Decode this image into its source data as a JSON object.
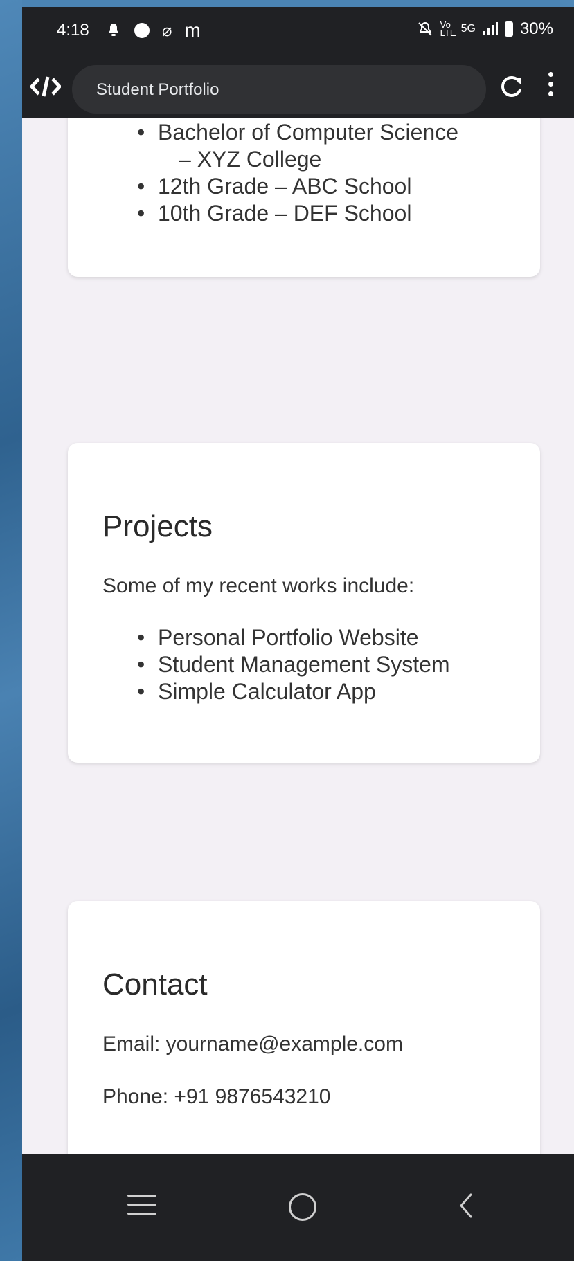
{
  "status_bar": {
    "time": "4:18",
    "left_icons": [
      "notification-icon",
      "compass-icon",
      "flash-icon",
      "m-app-icon"
    ],
    "left_glyphs": {
      "flash": "⌀",
      "m": "m"
    },
    "right_icons": [
      "mute-icon",
      "volte-icon",
      "5g-icon",
      "signal-icon",
      "battery-icon"
    ],
    "volte": "Vo LTE",
    "network": "5G",
    "battery": "30%"
  },
  "toolbar": {
    "page_title": "Student Portfolio",
    "icons": [
      "code-icon",
      "reload-icon",
      "more-vert-icon"
    ]
  },
  "education": {
    "items": [
      "Bachelor of Computer Science",
      "12th Grade – ABC School",
      "10th Grade – DEF School"
    ],
    "item1_continuation": "– XYZ College"
  },
  "projects": {
    "heading": "Projects",
    "intro": "Some of my recent works include:",
    "items": [
      "Personal Portfolio Website",
      "Student Management System",
      "Simple Calculator App"
    ]
  },
  "contact": {
    "heading": "Contact",
    "email": "Email: yourname@example.com",
    "phone": "Phone: +91 9876543210"
  },
  "nav_bar": {
    "icons": [
      "recents-icon",
      "home-icon",
      "back-icon"
    ]
  },
  "colors": {
    "background_outer": "#3f78a8",
    "chrome": "#202124",
    "url_bar": "#303134",
    "page_bg": "#f3f0f5",
    "card": "#ffffff"
  }
}
